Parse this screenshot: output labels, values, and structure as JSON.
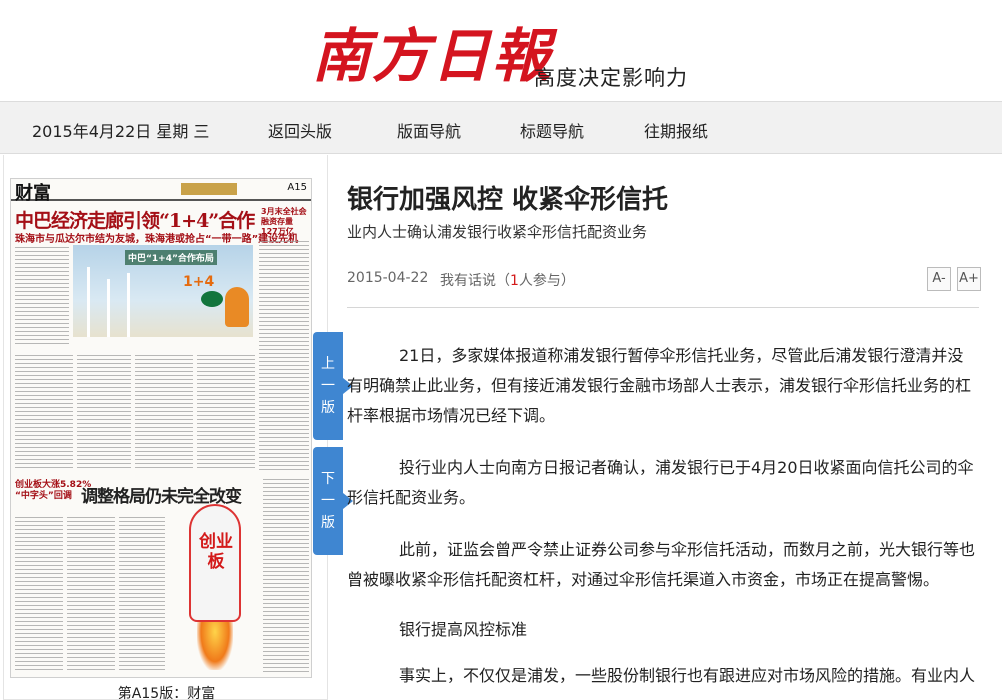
{
  "header": {
    "logo_text": "南方日報",
    "slogan": "高度决定影响力"
  },
  "nav": {
    "date": "2015年4月22日 星期 三",
    "links": [
      "返回头版",
      "版面导航",
      "标题导航",
      "往期报纸"
    ]
  },
  "newspaper": {
    "section": "财富",
    "page": "A15",
    "headline1": "中巴经济走廊引领“1+4”合作",
    "subhead1": "珠海市与瓜达尔市结为友城，珠海港或抢占“一带一路”建设先机",
    "side_note": "3月末全社会融资存量127万亿",
    "photo_label": "中巴“1+4”合作布局",
    "photo_label2": "1+4",
    "headline2": "调整格局仍未完全改变",
    "subhead2": "创业板大涨5.82%\n“中字头”回调",
    "rocket_text": "创业板",
    "caption": "第A15版：财富"
  },
  "side_tabs": {
    "prev": "上一版",
    "next": "下一版"
  },
  "article": {
    "title": "银行加强风控 收紧伞形信托",
    "subtitle": "业内人士确认浦发银行收紧伞形信托配资业务",
    "date": "2015-04-22",
    "comment_prefix": "我有话说（",
    "comment_count": "1",
    "comment_suffix": "人参与）",
    "font_minus": "A-",
    "font_plus": "A+",
    "paragraphs": [
      "21日，多家媒体报道称浦发银行暂停伞形信托业务，尽管此后浦发银行澄清并没有明确禁止此业务，但有接近浦发银行金融市场部人士表示，浦发银行伞形信托业务的杠杆率根据市场情况已经下调。",
      "投行业内人士向南方日报记者确认，浦发银行已于4月20日收紧面向信托公司的伞形信托配资业务。",
      "此前，证监会曾严令禁止证券公司参与伞形信托活动，而数月之前，光大银行等也曾被曝收紧伞形信托配资杠杆，对通过伞形信托渠道入市资金，市场正在提高警惕。",
      "银行提高风控标准",
      "事实上，不仅仅是浦发，一些股份制银行也有跟进应对市场风险的措施。有业内人"
    ]
  },
  "colors": {
    "brand_red": "#d4141f",
    "tab_blue": "#3f86d1",
    "nav_bg": "#f1f1f1"
  }
}
